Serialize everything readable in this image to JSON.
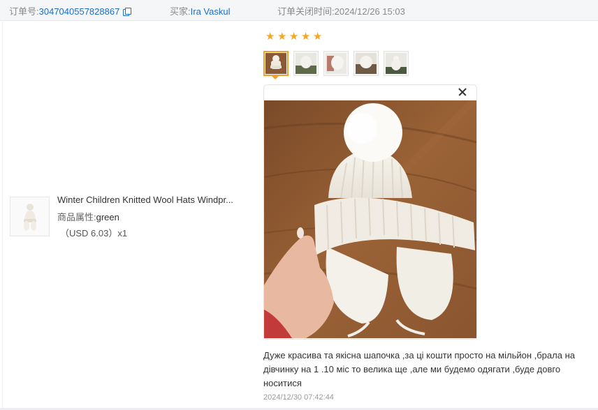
{
  "header": {
    "order_no_label": "订单号:",
    "order_no": "3047040557828867",
    "buyer_label": "买家:",
    "buyer_name": "Ira Vaskul",
    "close_time_label": "订单关闭时间:",
    "close_time": "2024/12/26 15:03"
  },
  "product": {
    "name": "Winter Children Knitted Wool Hats Windpr...",
    "attr_label": "商品属性:",
    "attr_value": "green",
    "price": "（USD  6.03）x1"
  },
  "review": {
    "rating": 5,
    "star_color": "#f5a623",
    "image_count": 5,
    "selected_image": 1,
    "text": "Дуже красива та якісна шапочка ,за ці кошти просто на мільйон ,брала на дівчинку на 1 .10 міс то велика ще ,але ми будемо одягати ,буде довго носитися",
    "date": "2024/12/30 07:42:44"
  },
  "colors": {
    "link": "#1c6ec8",
    "accent": "#f0a030"
  },
  "icons": {
    "copy": "copy-icon",
    "close": "close-icon",
    "star": "star-icon"
  }
}
